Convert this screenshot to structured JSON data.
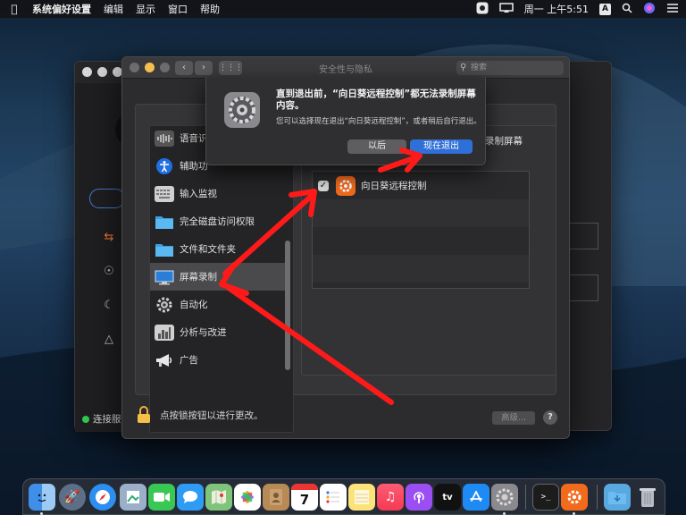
{
  "menubar": {
    "app_name": "系统偏好设置",
    "items": [
      "编辑",
      "显示",
      "窗口",
      "帮助"
    ],
    "clock": "周一 上午5:51",
    "input_badge": "A"
  },
  "window": {
    "title": "安全性与隐私",
    "search_placeholder": "搜索"
  },
  "sidebar": {
    "items": [
      {
        "label": "语音识",
        "icon": "waveform-icon"
      },
      {
        "label": "辅助功",
        "icon": "accessibility-icon"
      },
      {
        "label": "输入监视",
        "icon": "keyboard-icon"
      },
      {
        "label": "完全磁盘访问权限",
        "icon": "folder-icon"
      },
      {
        "label": "文件和文件夹",
        "icon": "folder-icon"
      },
      {
        "label": "屏幕录制",
        "icon": "display-icon"
      },
      {
        "label": "自动化",
        "icon": "gear-icon"
      },
      {
        "label": "分析与改进",
        "icon": "chart-icon"
      },
      {
        "label": "广告",
        "icon": "megaphone-icon"
      }
    ],
    "selected_index": 5
  },
  "permission": {
    "label_fragment": "录制屏幕",
    "apps": [
      {
        "name": "向日葵远程控制",
        "checked": true
      }
    ]
  },
  "footer": {
    "lock_text": "点按锁按钮以进行更改。",
    "advanced_label": "高级...",
    "help_label": "?"
  },
  "alert": {
    "title": "直到退出前，“向日葵远程控制”都无法录制屏幕内容。",
    "body": "您可以选择现在退出“向日葵远程控制”，或者稍后自行退出。",
    "later_label": "以后",
    "quit_label": "现在退出"
  },
  "back_window": {
    "status_text": "连接服"
  },
  "colors": {
    "accent_blue": "#2f6fd8",
    "arrow_red": "#ff1a1a",
    "sunlogin_orange": "#f26b1d",
    "status_green": "#31c950"
  },
  "dock": {
    "apps": [
      "finder-icon",
      "launchpad-icon",
      "safari-icon",
      "preview-icon",
      "facetime-icon",
      "messages-icon",
      "maps-icon",
      "photos-icon",
      "contacts-icon",
      "calendar-icon",
      "reminders-icon",
      "notes-icon",
      "music-icon",
      "podcasts-icon",
      "tv-icon",
      "appstore-icon",
      "system-preferences-icon",
      "terminal-icon",
      "sunlogin-icon",
      "downloads-folder-icon",
      "trash-icon"
    ],
    "calendar_day": "7",
    "tv_label": "tv"
  }
}
